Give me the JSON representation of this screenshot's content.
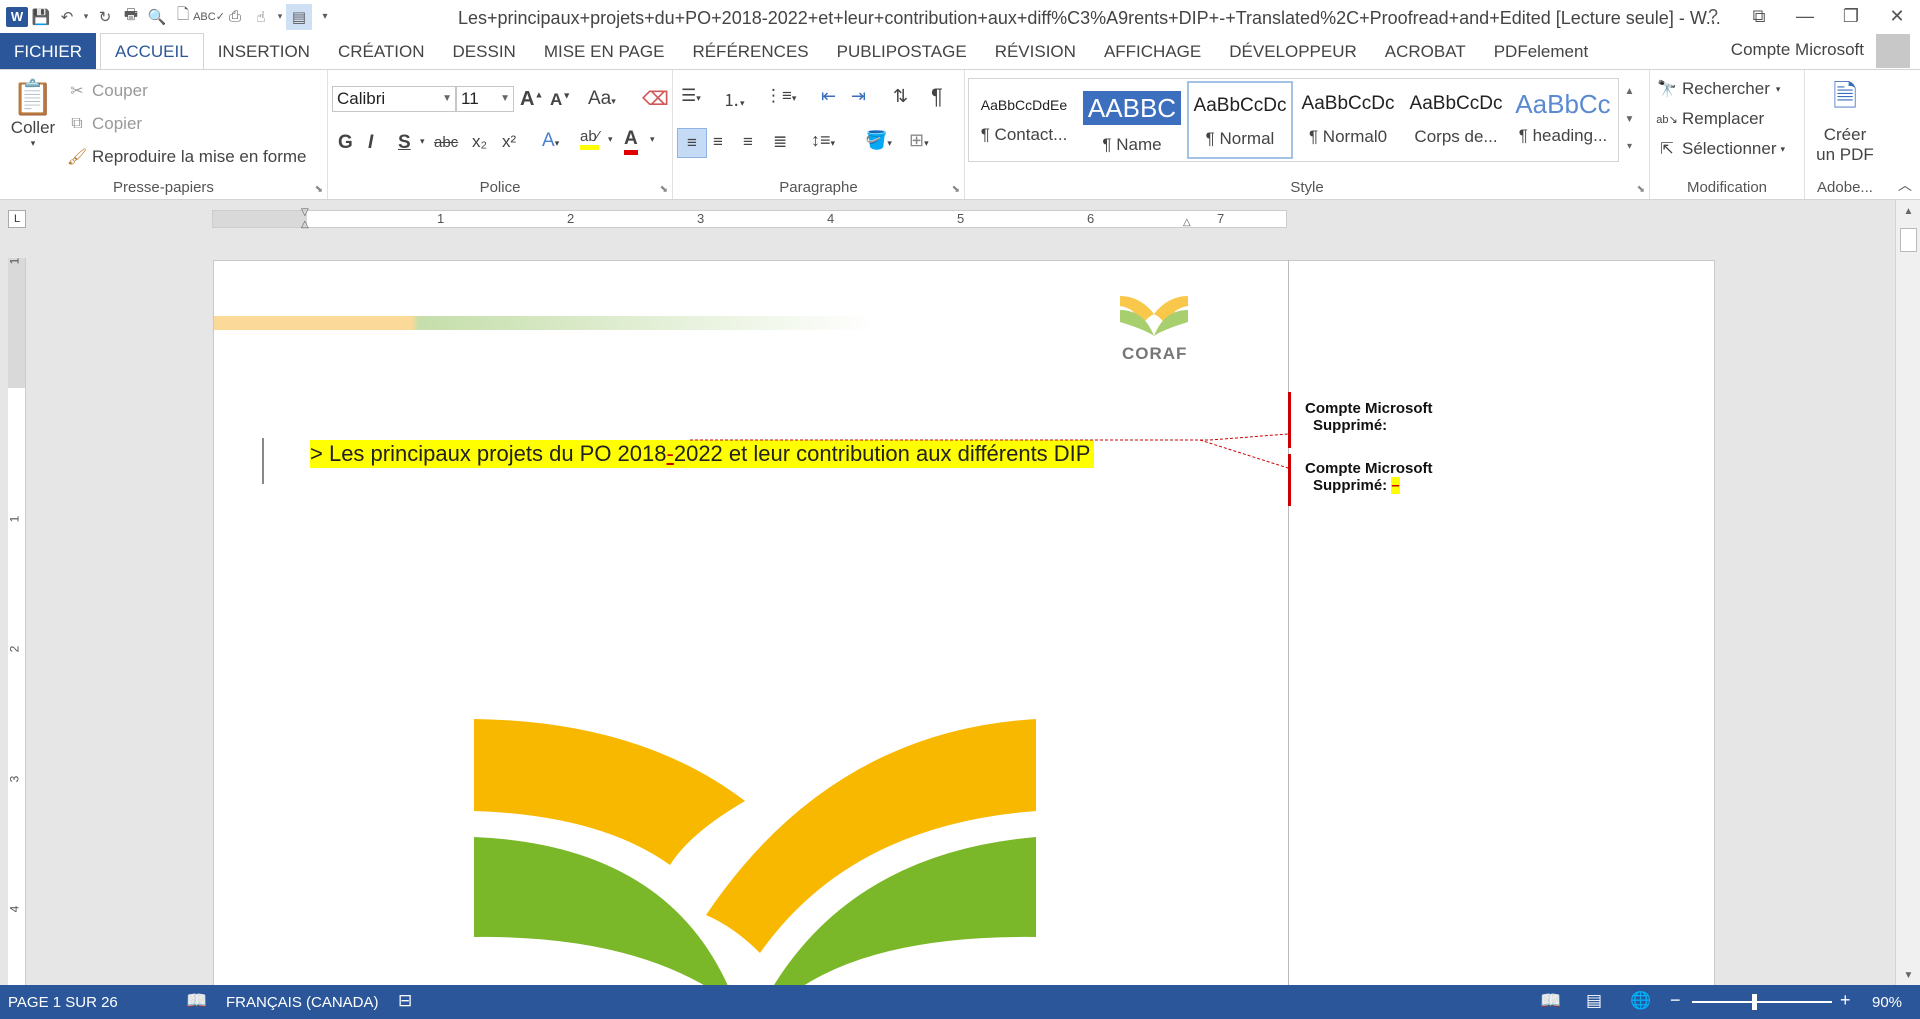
{
  "titlebar": {
    "title": "Les+principaux+projets+du+PO+2018-2022+et+leur+contribution+aux+diff%C3%A9rents+DIP+-+Translated%2C+Proofread+and+Edited [Lecture seule] - W...",
    "help": "?",
    "restore": "⧉",
    "minimize": "—",
    "maximize": "❐",
    "close": "✕"
  },
  "tabs": [
    "FICHIER",
    "ACCUEIL",
    "INSERTION",
    "CRÉATION",
    "DESSIN",
    "MISE EN PAGE",
    "RÉFÉRENCES",
    "PUBLIPOSTAGE",
    "RÉVISION",
    "AFFICHAGE",
    "DÉVELOPPEUR",
    "ACROBAT",
    "PDFelement"
  ],
  "account": "Compte Microsoft",
  "clipboard": {
    "paste": "Coller",
    "cut": "Couper",
    "copy": "Copier",
    "format_painter": "Reproduire la mise en forme",
    "label": "Presse-papiers"
  },
  "font": {
    "name": "Calibri",
    "size": "11",
    "label": "Police",
    "bold": "G",
    "italic": "I",
    "underline": "S",
    "strike": "abc",
    "sub": "x₂",
    "sup": "x²",
    "case": "Aa"
  },
  "paragraph": {
    "label": "Paragraphe"
  },
  "styles": {
    "label": "Style",
    "items": [
      {
        "preview": "AaBbCcDdEe",
        "name": "¶ Contact..."
      },
      {
        "preview": "AABBC",
        "name": "¶ Name"
      },
      {
        "preview": "AaBbCcDc",
        "name": "¶ Normal"
      },
      {
        "preview": "AaBbCcDc",
        "name": "¶ Normal0"
      },
      {
        "preview": "AaBbCcDc",
        "name": "Corps de..."
      },
      {
        "preview": "AaBbCc",
        "name": "¶ heading..."
      }
    ]
  },
  "editing": {
    "find": "Rechercher",
    "replace": "Remplacer",
    "select": "Sélectionner",
    "label": "Modification"
  },
  "adobe": {
    "create_line1": "Créer",
    "create_line2": "un PDF",
    "label": "Adobe..."
  },
  "ruler": {
    "h_numbers": [
      "1",
      "2",
      "3",
      "4",
      "5",
      "6",
      "7"
    ],
    "v_numbers": [
      "1",
      "1",
      "2",
      "3",
      "4"
    ]
  },
  "document": {
    "logo_text": "CORAF",
    "heading_prefix": ">   Les principaux projets du PO 2018",
    "heading_deleted": "-",
    "heading_suffix": "2022 et leur contribution aux différents DIP"
  },
  "comments": [
    {
      "author": "Compte Microsoft",
      "action": "Supprimé:",
      "deleted": ""
    },
    {
      "author": "Compte Microsoft",
      "action": "Supprimé:",
      "deleted": "–"
    }
  ],
  "status": {
    "page": "PAGE 1 SUR 26",
    "language": "FRANÇAIS (CANADA)",
    "zoom": "90%"
  },
  "colors": {
    "brand": "#2b579a",
    "highlight": "#ffff00",
    "track_change": "#cc0000",
    "logo_orange": "#f9b800",
    "logo_green": "#7ab829"
  }
}
